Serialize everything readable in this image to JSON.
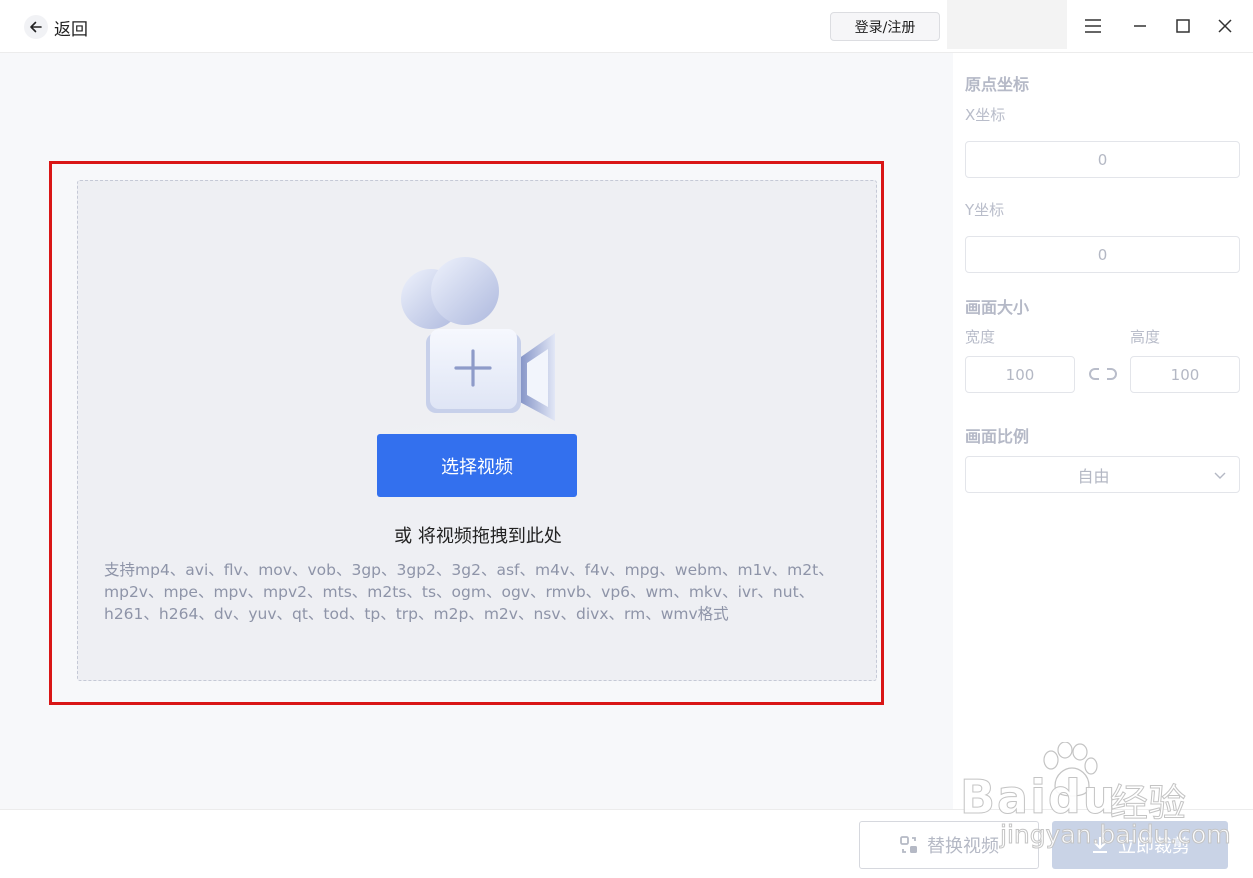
{
  "header": {
    "back_label": "返回",
    "login_label": "登录/注册"
  },
  "upload": {
    "select_button": "选择视频",
    "drop_hint": "或 将视频拖拽到此处",
    "formats": "支持mp4、avi、flv、mov、vob、3gp、3gp2、3g2、asf、m4v、f4v、mpg、webm、m1v、m2t、mp2v、mpe、mpv、mpv2、mts、m2ts、ts、ogm、ogv、rmvb、vp6、wm、mkv、ivr、nut、h261、h264、dv、yuv、qt、tod、tp、trp、m2p、m2v、nsv、divx、rm、wmv格式"
  },
  "panel": {
    "origin_title": "原点坐标",
    "x_label": "X坐标",
    "x_value": "0",
    "y_label": "Y坐标",
    "y_value": "0",
    "size_title": "画面大小",
    "width_label": "宽度",
    "width_value": "100",
    "height_label": "高度",
    "height_value": "100",
    "ratio_title": "画面比例",
    "ratio_value": "自由"
  },
  "footer": {
    "replace_label": "替换视频",
    "crop_label": "立即裁剪"
  },
  "watermark": {
    "brand": "Baidu",
    "brand_cn": "经验",
    "url": "jingyan.baidu.com"
  },
  "colors": {
    "accent": "#3370ee",
    "highlight_frame": "#d91616",
    "disabled_button": "#c9d3e6"
  }
}
